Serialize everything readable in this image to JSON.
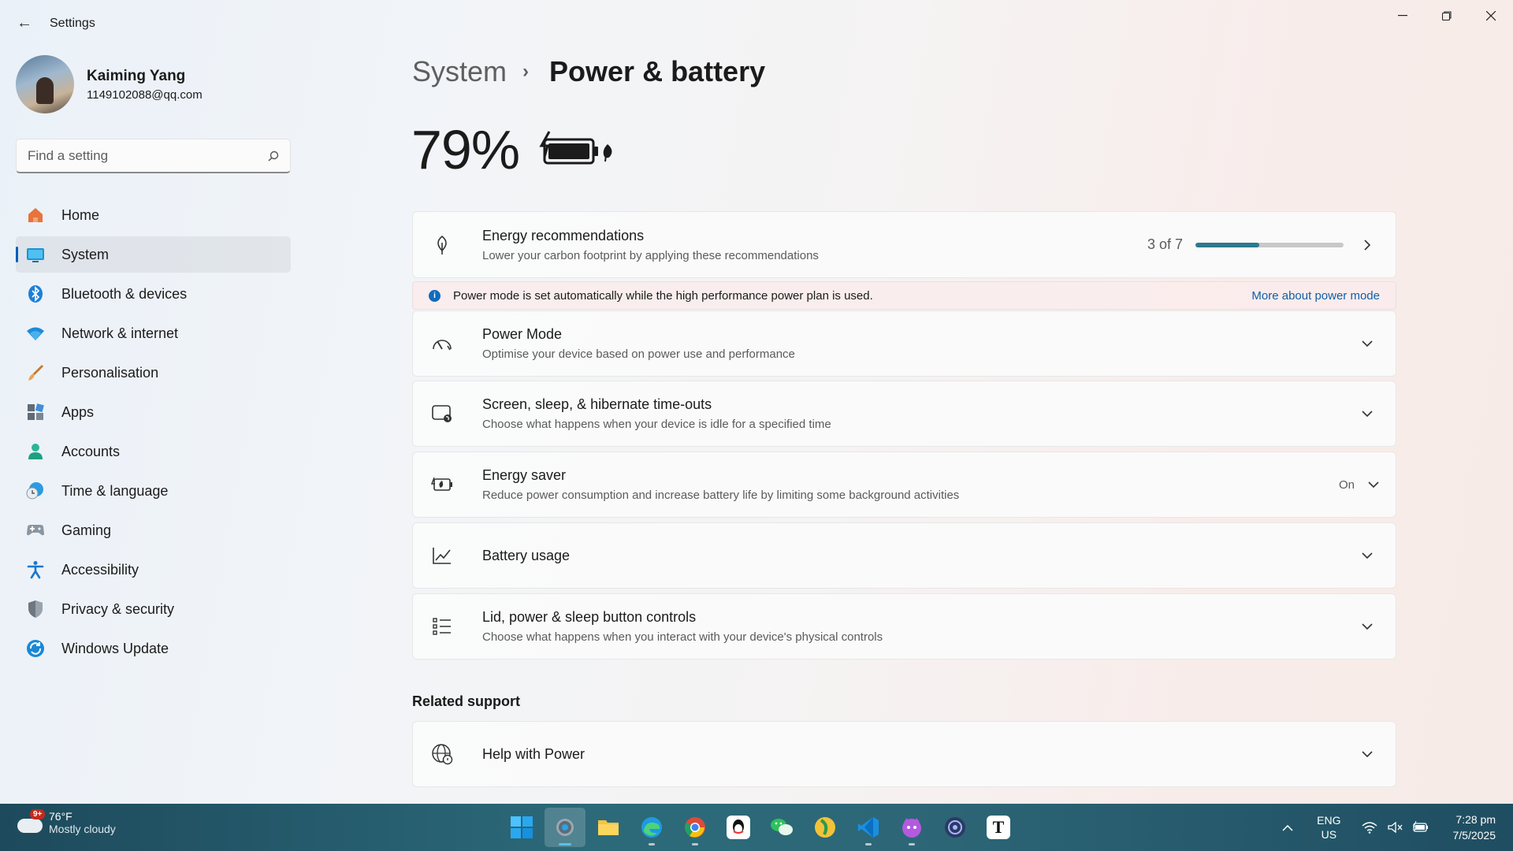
{
  "window": {
    "title": "Settings",
    "back_label": "←"
  },
  "profile": {
    "name": "Kaiming Yang",
    "email": "1149102088@qq.com"
  },
  "search": {
    "placeholder": "Find a setting"
  },
  "nav": {
    "items": [
      {
        "label": "Home",
        "icon": "home-icon"
      },
      {
        "label": "System",
        "icon": "system-icon",
        "active": true
      },
      {
        "label": "Bluetooth & devices",
        "icon": "bluetooth-icon"
      },
      {
        "label": "Network & internet",
        "icon": "wifi-icon"
      },
      {
        "label": "Personalisation",
        "icon": "brush-icon"
      },
      {
        "label": "Apps",
        "icon": "apps-icon"
      },
      {
        "label": "Accounts",
        "icon": "accounts-icon"
      },
      {
        "label": "Time & language",
        "icon": "clock-globe-icon"
      },
      {
        "label": "Gaming",
        "icon": "gamepad-icon"
      },
      {
        "label": "Accessibility",
        "icon": "accessibility-icon"
      },
      {
        "label": "Privacy & security",
        "icon": "shield-icon"
      },
      {
        "label": "Windows Update",
        "icon": "update-icon"
      }
    ]
  },
  "breadcrumb": {
    "parent": "System",
    "current": "Power & battery"
  },
  "battery": {
    "percent": "79%"
  },
  "energy_recommendations": {
    "title": "Energy recommendations",
    "subtitle": "Lower your carbon footprint by applying these recommendations",
    "progress_label": "3 of 7",
    "progress_fraction": 0.4286
  },
  "info_bar": {
    "message": "Power mode is set automatically while the high performance power plan is used.",
    "link": "More about power mode"
  },
  "cards": {
    "power_mode": {
      "title": "Power Mode",
      "subtitle": "Optimise your device based on power use and performance"
    },
    "screen_sleep": {
      "title": "Screen, sleep, & hibernate time-outs",
      "subtitle": "Choose what happens when your device is idle for a specified time"
    },
    "energy_saver": {
      "title": "Energy saver",
      "subtitle": "Reduce power consumption and increase battery life by limiting some background activities",
      "state": "On"
    },
    "battery_usage": {
      "title": "Battery usage"
    },
    "lid_controls": {
      "title": "Lid, power & sleep button controls",
      "subtitle": "Choose what happens when you interact with your device's physical controls"
    }
  },
  "related_support": {
    "heading": "Related support",
    "help_power": {
      "title": "Help with Power"
    }
  },
  "taskbar": {
    "weather": {
      "temp": "76°F",
      "desc": "Mostly cloudy",
      "badge": "9+"
    },
    "apps": [
      "start",
      "settings",
      "file-explorer",
      "edge",
      "chrome",
      "qq",
      "wechat",
      "app-yellow",
      "vscode",
      "app-cat",
      "app-blue",
      "typora"
    ],
    "lang_primary": "ENG",
    "lang_secondary": "US",
    "time": "7:28 pm",
    "date": "7/5/2025"
  },
  "colors": {
    "accent": "#005fb8",
    "progress": "#2b7a8e",
    "info_link": "#0f5fa8"
  }
}
